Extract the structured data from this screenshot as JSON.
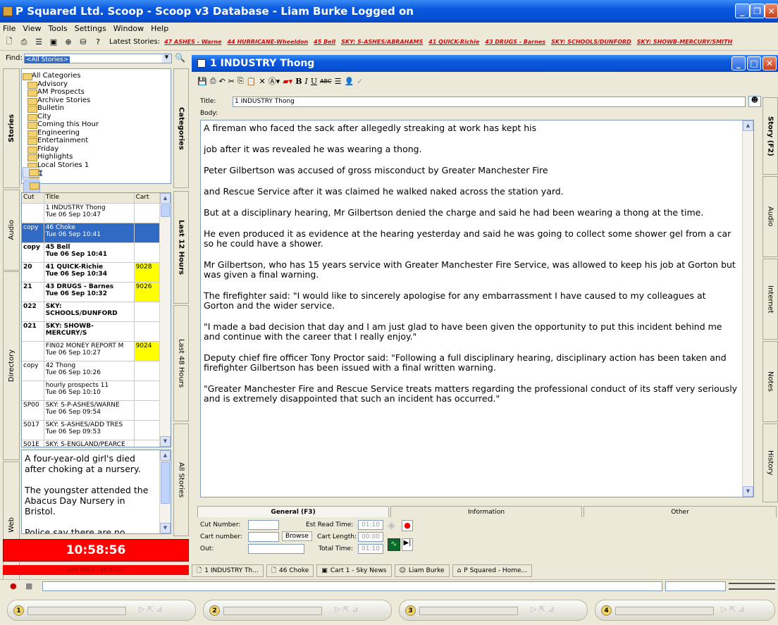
{
  "window": {
    "title": "P Squared Ltd. Scoop - Scoop v3 Database - Liam Burke Logged on"
  },
  "menu": [
    "File",
    "View",
    "Tools",
    "Settings",
    "Window",
    "Help"
  ],
  "toolbar": {
    "latest_label": "Latest Stories:",
    "latest": [
      "47 ASHES - Warne",
      "44 HURRICANE-Wheeldon",
      "45 Bell",
      "SKY: S-ASHES/ABRAHAMS",
      "41 QUICK-Richie",
      "43 DRUGS - Barnes",
      "SKY: SCHOOLS/DUNFORD",
      "SKY: SHOWB-MERCURY/SMITH"
    ]
  },
  "find": {
    "label": "Find:",
    "value": "<All Stories>"
  },
  "left_tabs": [
    "Stories",
    "Audio",
    "Directory",
    "Web"
  ],
  "right_tabs": [
    "Categories",
    "Last 12 Hours",
    "Last 48 Hours",
    "All Stories"
  ],
  "categories": [
    "All Categories",
    "Advisory",
    "AM Prospects",
    "Archive Stories",
    "Bulletin",
    "City",
    "Coming this Hour",
    "Engineering",
    "Entertainment",
    "Friday",
    "Highlights",
    "Local Stories 1"
  ],
  "story_list": {
    "headers": [
      "Cut",
      "Title",
      "Cart"
    ],
    "rows": [
      {
        "cut": "",
        "title": "1 INDUSTRY Thong",
        "time": "Tue 06 Sep 10:47",
        "cart": "",
        "bold": false,
        "sel": false,
        "yellow": false
      },
      {
        "cut": "copy",
        "title": "46 Choke",
        "time": "Tue 06 Sep 10:41",
        "cart": "",
        "bold": false,
        "sel": true,
        "yellow": false
      },
      {
        "cut": "copy",
        "title": "45 Bell",
        "time": "Tue 06 Sep 10:41",
        "cart": "",
        "bold": true,
        "sel": false,
        "yellow": false
      },
      {
        "cut": "20",
        "title": "41 QUICK-Richie",
        "time": "Tue 06 Sep 10:34",
        "cart": "9028",
        "bold": true,
        "sel": false,
        "yellow": true
      },
      {
        "cut": "21",
        "title": "43 DRUGS - Barnes",
        "time": "Tue 06 Sep 10:32",
        "cart": "9026",
        "bold": true,
        "sel": false,
        "yellow": true
      },
      {
        "cut": "022",
        "title": "SKY: SCHOOLS/DUNFORD",
        "time": "",
        "cart": "",
        "bold": true,
        "sel": false,
        "yellow": false
      },
      {
        "cut": "021",
        "title": "SKY: SHOWB-MERCURY/S",
        "time": "",
        "cart": "",
        "bold": true,
        "sel": false,
        "yellow": false
      },
      {
        "cut": "",
        "title": "FIN02 MONEY REPORT M",
        "time": "Tue 06 Sep 10:27",
        "cart": "9024",
        "bold": false,
        "sel": false,
        "yellow": true
      },
      {
        "cut": "copy",
        "title": "42 Thong",
        "time": "Tue 06 Sep 10:26",
        "cart": "",
        "bold": false,
        "sel": false,
        "yellow": false
      },
      {
        "cut": "",
        "title": "hourly prospects 11",
        "time": "Tue 06 Sep 10:10",
        "cart": "",
        "bold": false,
        "sel": false,
        "yellow": false
      },
      {
        "cut": "SP00",
        "title": "SKY: S-P-ASHES/WARNE",
        "time": "Tue 06 Sep 09:54",
        "cart": "",
        "bold": false,
        "sel": false,
        "yellow": false
      },
      {
        "cut": "S017",
        "title": "SKY: S-ASHES/ADD TRES",
        "time": "Tue 06 Sep 09:53",
        "cart": "",
        "bold": false,
        "sel": false,
        "yellow": false
      },
      {
        "cut": "S01E",
        "title": "SKY: S-ENGLAND/PEARCE",
        "time": "",
        "cart": "",
        "bold": false,
        "sel": false,
        "yellow": false
      }
    ]
  },
  "preview": {
    "lines": [
      "A four-year-old girl's died after choking at a nursery.",
      "The youngster attended the Abacus Day Nursery in Bristol.",
      "Police say there are no"
    ]
  },
  "clock": "10:58:56",
  "clock_sub": "Cart 9033 - 10:57:07",
  "story": {
    "window_title": "1 INDUSTRY Thong",
    "title_label": "Title:",
    "title_value": "1 INDUSTRY Thong",
    "body_label": "Body:",
    "paragraphs": [
      "A fireman who faced the sack after allegedly streaking at work has kept his",
      "job after it was revealed he was wearing a thong.",
      " Peter Gilbertson was accused of gross misconduct by Greater Manchester Fire",
      "and Rescue Service after it was claimed he walked naked across the station yard.",
      " But at a disciplinary hearing, Mr Gilbertson denied the charge and said he had been wearing a thong at the time.",
      " He even produced it as evidence at the hearing yesterday and said he was going to collect some shower gel from a car so he could have a shower.",
      " Mr Gilbertson, who has 15 years service with Greater Manchester Fire Service, was allowed to keep his job at Gorton but was given a final warning.",
      " The firefighter said: \"I would like to sincerely apologise for any embarrassment I have caused to my colleagues at Gorton and the wider service.",
      " \"I made a bad decision that day and I am just glad to have been given the opportunity to put this incident behind me and continue with the career that I really enjoy.\"",
      " Deputy chief fire officer Tony Proctor said: \"Following a full disciplinary hearing, disciplinary action has been taken and firefighter Gilbertson has been issued with a final written warning.",
      " \"Greater Manchester Fire and Rescue Service treats matters regarding the professional conduct of its staff very seriously and is extremely disappointed that such an incident has occurred.\""
    ],
    "side_tabs": [
      "Story (F2)",
      "Audio",
      "Internet",
      "Notes",
      "History"
    ]
  },
  "bottom": {
    "tabs": [
      "General (F3)",
      "Information",
      "Other"
    ],
    "cut_number": "Cut Number:",
    "cart_number": "Cart number:",
    "out": "Out:",
    "browse": "Browse",
    "est_read": "Est Read Time:",
    "est_val": "01:10",
    "cart_length": "Cart Length:",
    "cart_len_val": "00:00",
    "total_time": "Total Time:",
    "total_val": "01:10"
  },
  "taskbar": [
    "1 INDUSTRY Th...",
    "46 Choke",
    "Cart 1 - Sky News",
    "Liam Burke",
    "P Squared - Home..."
  ],
  "players": [
    "1",
    "2",
    "3",
    "4"
  ]
}
